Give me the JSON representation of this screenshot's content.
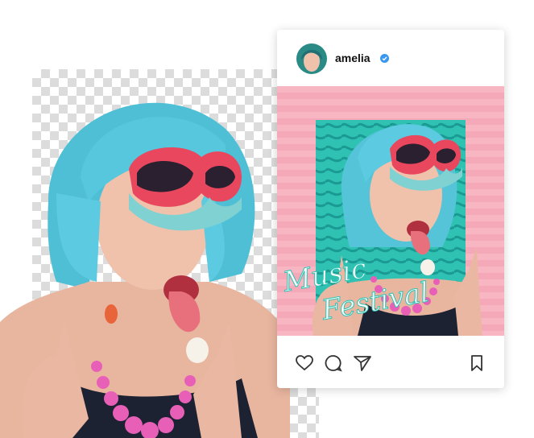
{
  "post": {
    "username": "amelia",
    "verified": true,
    "overlay_line1": "Music",
    "overlay_line2": "Festival"
  },
  "actions": {
    "icons": [
      "heart-icon",
      "comment-icon",
      "share-icon",
      "bookmark-icon"
    ]
  },
  "colors": {
    "pink_bg": "#f7b4c0",
    "teal_pattern": "#2fc2b3",
    "hair": "#55c4d8",
    "verified_blue": "#3897f0",
    "checker": "#dcdcdc"
  }
}
